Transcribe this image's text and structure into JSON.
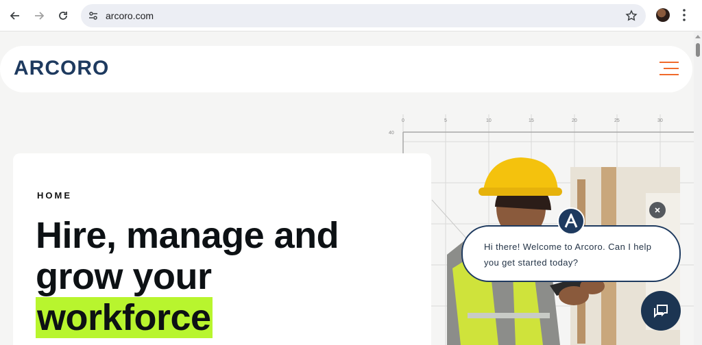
{
  "browser": {
    "url": "arcoro.com",
    "icons": {
      "back": "back-arrow-icon",
      "forward": "forward-arrow-icon",
      "reload": "reload-icon",
      "site_settings": "tune-icon",
      "bookmark": "star-icon",
      "profile": "avatar",
      "menu": "kebab-menu-icon"
    }
  },
  "site": {
    "logo_text": "ARCORO",
    "menu_icon": "hamburger-icon",
    "colors": {
      "brand_navy": "#1e3a5f",
      "accent_orange": "#f06a2a",
      "highlight_green": "#b8f52e"
    }
  },
  "hero": {
    "eyebrow": "HOME",
    "headline_line1": "Hire, manage and",
    "headline_line2": "grow your",
    "headline_highlight": "workforce"
  },
  "grid": {
    "x_ticks": [
      "0",
      "5",
      "10",
      "15",
      "20",
      "25",
      "30"
    ],
    "y_tick": "40"
  },
  "chat": {
    "message": "Hi there! Welcome to Arcoro. Can I help you get started today?",
    "avatar_letter": "A",
    "close_icon": "close-icon",
    "launcher_icon": "chat-icon"
  }
}
